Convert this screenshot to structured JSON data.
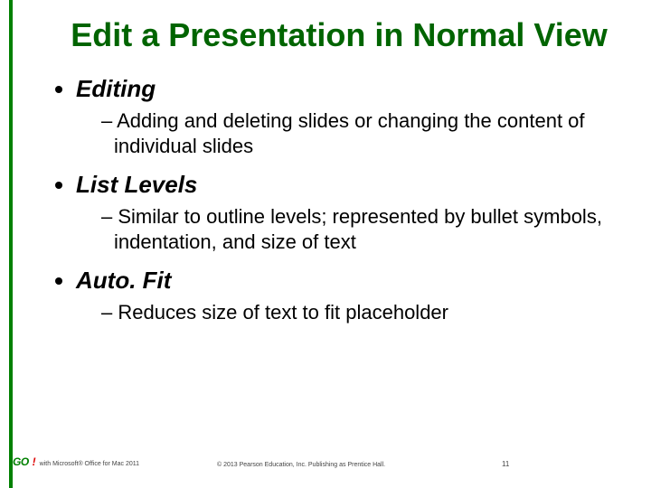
{
  "title": "Edit a Presentation in Normal View",
  "items": [
    {
      "heading": "Editing",
      "sub": "– Adding and deleting slides or changing the content of individual slides"
    },
    {
      "heading": "List Levels",
      "sub": "– Similar to outline levels; represented by bullet symbols, indentation, and size of text"
    },
    {
      "heading": "Auto. Fit",
      "sub": "– Reduces size of text to fit placeholder"
    }
  ],
  "footer": {
    "brand_go": "GO",
    "brand_bang": "!",
    "brand_sub": "with Microsoft®  Office for Mac 2011",
    "copyright": "© 2013 Pearson Education, Inc. Publishing as Prentice Hall.",
    "page": "11"
  }
}
